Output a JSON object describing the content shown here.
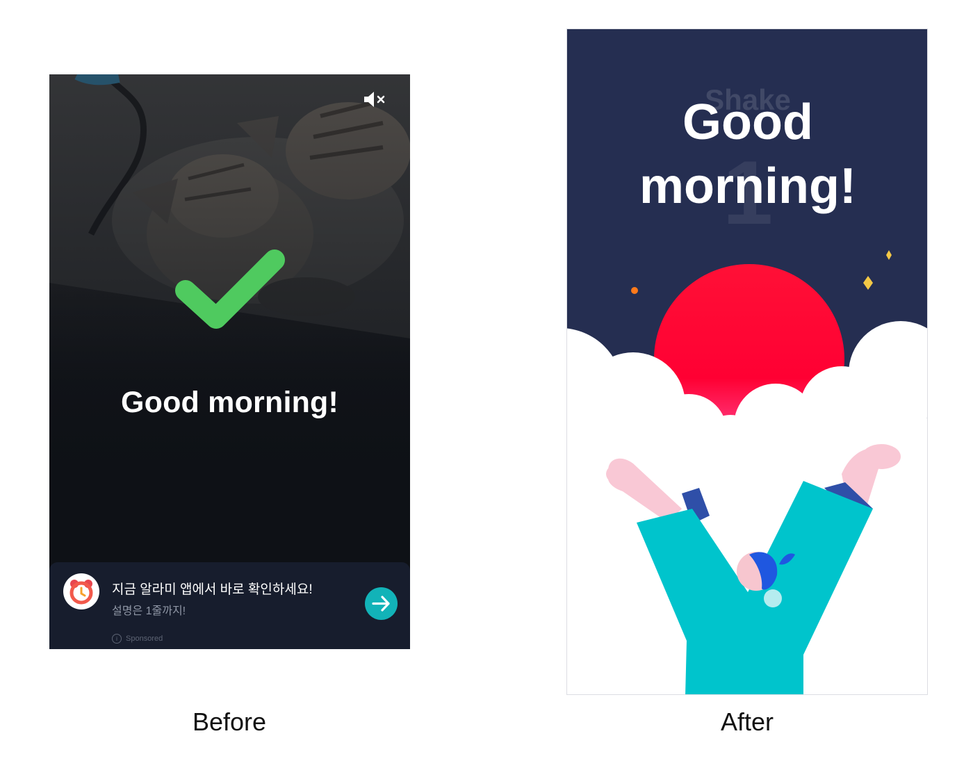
{
  "before": {
    "greeting": "Good morning!",
    "mute_icon": "volume-mute-icon",
    "check_icon": "checkmark-icon",
    "check_color": "#4fca5f",
    "ad": {
      "title": "지금 알라미 앱에서 바로 확인하세요!",
      "subtitle": "설명은 1줄까지!",
      "sponsored_label": "Sponsored",
      "logo_icon": "alarmy-alarm-clock-logo",
      "arrow_icon": "arrow-right-icon",
      "arrow_color": "#12b3b8"
    }
  },
  "after": {
    "greeting_line1": "Good",
    "greeting_line2": "morning!",
    "background_word": "Shake",
    "background_number": "1",
    "sun_color": "#ff0033",
    "sky_color": "#252e51",
    "sweater_color": "#00c4cc"
  },
  "captions": {
    "before": "Before",
    "after": "After"
  }
}
